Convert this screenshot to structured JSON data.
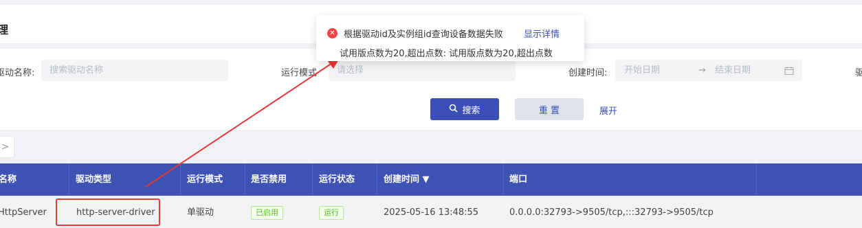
{
  "header": {
    "title": "理"
  },
  "filters": {
    "driver_name_label": "驱动名称:",
    "driver_name_placeholder": "搜索驱动名称",
    "run_mode_label": "运行模式",
    "run_mode_placeholder": "请选择",
    "created_label": "创建时间:",
    "start_placeholder": "开始日期",
    "range_arrow": "→",
    "end_placeholder": "结束日期",
    "next_label": "驱",
    "search_label": "搜索",
    "reset_label": "重 置",
    "expand_label": "展开"
  },
  "pager": {
    "next": ">"
  },
  "table": {
    "columns": [
      "名称",
      "驱动类型",
      "运行模式",
      "是否禁用",
      "运行状态",
      "创建时间 ▼",
      "端口"
    ],
    "rows": [
      {
        "name": "HttpServer",
        "driver_type": "http-server-driver",
        "run_mode": "单驱动",
        "disabled": "已启用",
        "status": "运行",
        "created": "2025-05-16 13:48:55",
        "port": "0.0.0.0:32793->9505/tcp,:::32793->9505/tcp"
      }
    ]
  },
  "toast": {
    "icon": "error-icon",
    "title": "根据驱动id及实例组id查询设备数据失败",
    "link": "显示详情",
    "detail": "试用版点数为20,超出点数: 试用版点数为20,超出点数"
  },
  "colors": {
    "primary": "#3f53b5",
    "error": "#f04444",
    "success": "#52c41a",
    "annotation": "#e53935"
  }
}
